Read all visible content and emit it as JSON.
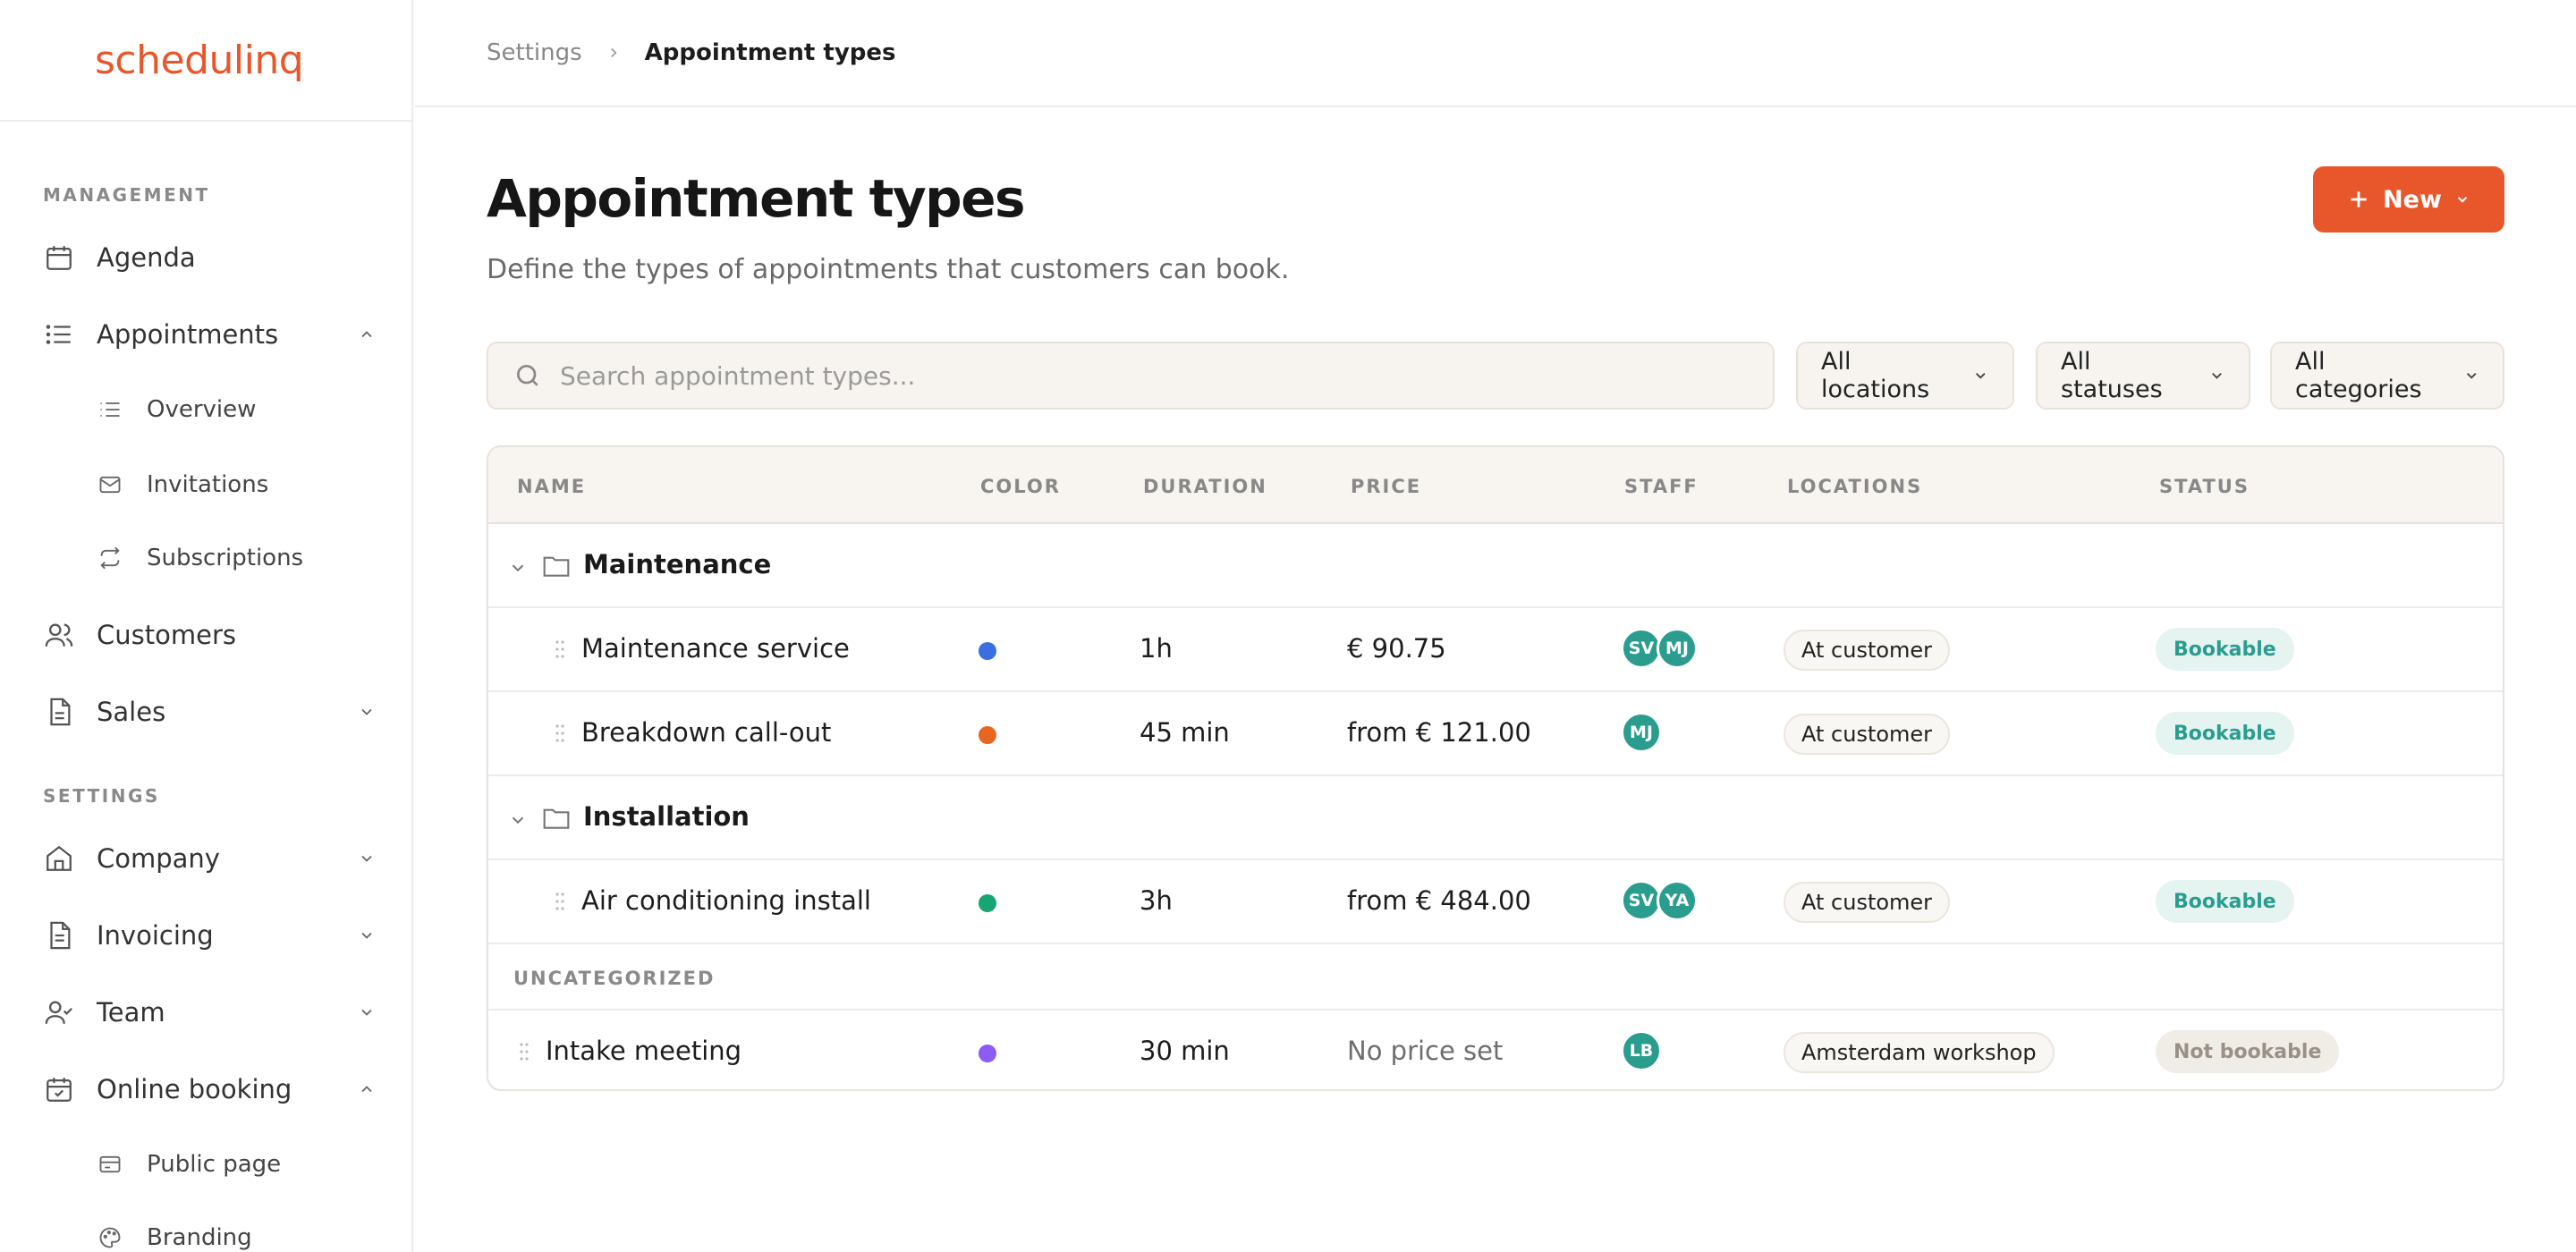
{
  "app": {
    "logo_text": "schedulinq"
  },
  "sidebar": {
    "management_title": "MANAGEMENT",
    "settings_title": "SETTINGS",
    "agenda": "Agenda",
    "appointments": "Appointments",
    "overview": "Overview",
    "invitations": "Invitations",
    "subscriptions": "Subscriptions",
    "customers": "Customers",
    "sales": "Sales",
    "company": "Company",
    "invoicing": "Invoicing",
    "team": "Team",
    "online_booking": "Online booking",
    "public_page": "Public page",
    "branding": "Branding"
  },
  "breadcrumb": {
    "parent": "Settings",
    "current": "Appointment types"
  },
  "header": {
    "title": "Appointment types",
    "subtitle": "Define the types of appointments that customers can book.",
    "new_button": "New"
  },
  "filters": {
    "search_placeholder": "Search appointment types...",
    "locations": "All locations",
    "statuses": "All statuses",
    "categories": "All categories"
  },
  "table": {
    "columns": {
      "name": "NAME",
      "color": "COLOR",
      "duration": "DURATION",
      "price": "PRICE",
      "staff": "STAFF",
      "locations": "LOCATIONS",
      "status": "STATUS"
    },
    "group_maintenance": "Maintenance",
    "group_installation": "Installation",
    "uncategorized": "UNCATEGORIZED",
    "rows": [
      {
        "name": "Maintenance service",
        "color": "#3b6fe0",
        "duration": "1h",
        "price": "€ 90.75",
        "staff": [
          "SV",
          "MJ"
        ],
        "location": "At customer",
        "status": "Bookable"
      },
      {
        "name": "Breakdown call-out",
        "color": "#e8661f",
        "duration": "45 min",
        "price": "from € 121.00",
        "staff": [
          "MJ"
        ],
        "location": "At customer",
        "status": "Bookable"
      },
      {
        "name": "Air conditioning install",
        "color": "#17a673",
        "duration": "3h",
        "price": "from € 484.00",
        "staff": [
          "SV",
          "YA"
        ],
        "location": "At customer",
        "status": "Bookable"
      },
      {
        "name": "Intake meeting",
        "color": "#8b5cf6",
        "duration": "30 min",
        "price": "No price set",
        "staff": [
          "LB"
        ],
        "location": "Amsterdam workshop",
        "status": "Not bookable"
      }
    ]
  },
  "colors": {
    "accent": "#e8572c",
    "teal": "#2a9d8f"
  }
}
